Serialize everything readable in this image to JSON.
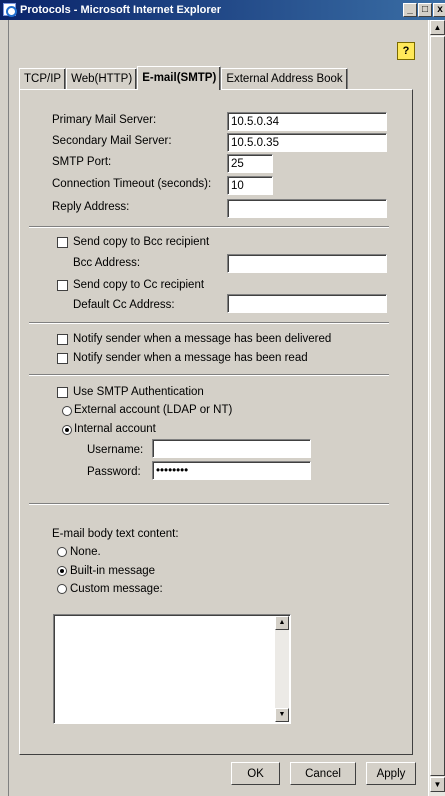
{
  "window": {
    "title": "Protocols - Microsoft Internet Explorer",
    "minimize": "_",
    "restore": "□",
    "close": "x"
  },
  "help_icon": "?",
  "tabs": [
    {
      "label": "TCP/IP",
      "active": false
    },
    {
      "label": "Web(HTTP)",
      "active": false
    },
    {
      "label": "E-mail(SMTP)",
      "active": true
    },
    {
      "label": "External Address Book",
      "active": false
    }
  ],
  "smtp": {
    "primary_label": "Primary Mail Server:",
    "primary_value": "10.5.0.34",
    "secondary_label": "Secondary Mail Server:",
    "secondary_value": "10.5.0.35",
    "port_label": "SMTP Port:",
    "port_value": "25",
    "timeout_label": "Connection Timeout (seconds):",
    "timeout_value": "10",
    "reply_label": "Reply Address:",
    "reply_value": ""
  },
  "copies": {
    "bcc_check_label": "Send copy to Bcc recipient",
    "bcc_checked": false,
    "bcc_addr_label": "Bcc Address:",
    "bcc_addr_value": "",
    "cc_check_label": "Send copy to Cc recipient",
    "cc_checked": false,
    "cc_addr_label": "Default Cc Address:",
    "cc_addr_value": ""
  },
  "notify": {
    "delivered_label": "Notify sender when a message has been delivered",
    "delivered_checked": false,
    "read_label": "Notify sender when a message has been read",
    "read_checked": false
  },
  "auth": {
    "use_label": "Use SMTP Authentication",
    "use_checked": false,
    "external_label": "External account (LDAP or NT)",
    "external_selected": false,
    "internal_label": "Internal account",
    "internal_selected": true,
    "username_label": "Username:",
    "username_value": "",
    "password_label": "Password:",
    "password_value": "********"
  },
  "body_content": {
    "heading": "E-mail body text content:",
    "none_label": "None.",
    "none_selected": false,
    "builtin_label": "Built-in message",
    "builtin_selected": true,
    "custom_label": "Custom message:",
    "custom_selected": false,
    "custom_text": ""
  },
  "buttons": {
    "ok": "OK",
    "cancel": "Cancel",
    "apply": "Apply"
  }
}
